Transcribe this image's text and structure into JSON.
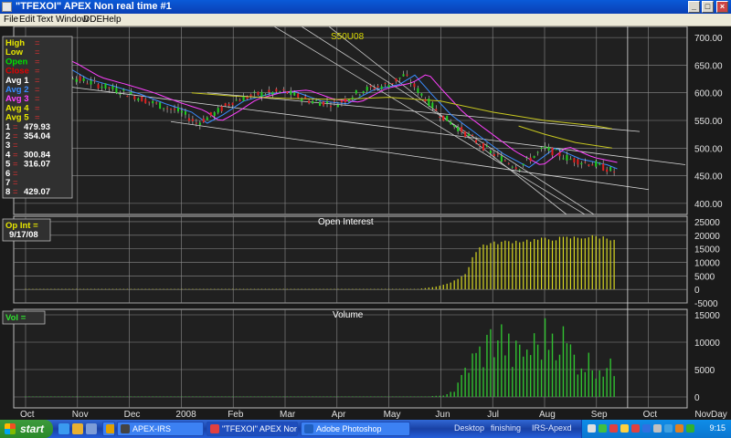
{
  "window": {
    "title": "\"TFEXOI\" APEX Non real time #1",
    "buttons": [
      "_",
      "□",
      "×"
    ]
  },
  "menu": [
    "File",
    "Edit",
    "Text",
    "Window",
    "DDE",
    "Help"
  ],
  "price_panel": {
    "symbol_label": "S50U08",
    "y_ticks": [
      "700.00",
      "650.00",
      "600.00",
      "550.00",
      "500.00",
      "450.00",
      "400.00"
    ],
    "legend": [
      {
        "label": "High",
        "value": "=",
        "color": "#e8e800"
      },
      {
        "label": "Low",
        "value": "=",
        "color": "#e8e800"
      },
      {
        "label": "Open",
        "value": "=",
        "color": "#00e000"
      },
      {
        "label": "Close",
        "value": "=",
        "color": "#e00000"
      },
      {
        "label": "Avg 1",
        "value": "=",
        "color": "#ffffff"
      },
      {
        "label": "Avg 2",
        "value": "=",
        "color": "#3a8cff"
      },
      {
        "label": "Avg 3",
        "value": "=",
        "color": "#ff40ff"
      },
      {
        "label": "Avg 4",
        "value": "=",
        "color": "#e8e800"
      },
      {
        "label": "Avg 5",
        "value": "=",
        "color": "#e8e800"
      },
      {
        "label": "1",
        "value": "= 479.93",
        "color": "#ffffff"
      },
      {
        "label": "2",
        "value": "= 354.04",
        "color": "#ffffff"
      },
      {
        "label": "3",
        "value": "=",
        "color": "#ffffff"
      },
      {
        "label": "4",
        "value": "= 300.84",
        "color": "#ffffff"
      },
      {
        "label": "5",
        "value": "= 316.07",
        "color": "#ffffff"
      },
      {
        "label": "6",
        "value": "=",
        "color": "#ffffff"
      },
      {
        "label": "7",
        "value": "=",
        "color": "#ffffff"
      },
      {
        "label": "8",
        "value": "= 429.07",
        "color": "#ffffff"
      }
    ]
  },
  "oi_panel": {
    "title": "Open  Interest",
    "label": "Op  Int  =",
    "date": "9/17/08",
    "y_ticks": [
      "25000",
      "20000",
      "15000",
      "10000",
      "5000",
      "0",
      "-5000"
    ]
  },
  "vol_panel": {
    "title": "Volume",
    "label": "Vol    =",
    "y_ticks": [
      "15000",
      "10000",
      "5000",
      "0"
    ]
  },
  "x_axis": [
    "Oct",
    "Nov",
    "Dec",
    "2008",
    "Feb",
    "Mar",
    "Apr",
    "May",
    "Jun",
    "Jul",
    "Aug",
    "Sep",
    "Oct",
    "Nov",
    "Day"
  ],
  "colors": {
    "grid": "#8c8c8c",
    "panel_bg": "#202020",
    "oi_bar": "#d8d820",
    "vol_bar": "#30c030",
    "axis_text": "#e0e0e0"
  },
  "taskbar": {
    "start": "start",
    "tasks": [
      {
        "label": "",
        "icon_color": "#e0a000"
      },
      {
        "label": "APEX-IRS",
        "icon_color": "#444444"
      },
      {
        "label": "\"TFEXOI\" APEX Non r...",
        "icon_color": "#e04040"
      },
      {
        "label": "Adobe Photoshop",
        "icon_color": "#2060c0"
      }
    ],
    "tray_labels": [
      "Desktop",
      "finishing",
      "IRS-Apexd"
    ],
    "clock": "9:15"
  },
  "chart_data": {
    "type": "candlestick-with-histograms",
    "x_labels": [
      "Oct",
      "Nov",
      "Dec",
      "2008",
      "Feb",
      "Mar",
      "Apr",
      "May",
      "Jun",
      "Jul",
      "Aug",
      "Sep",
      "Oct",
      "Nov"
    ],
    "price_ylim": [
      380,
      720
    ],
    "price_ticks": [
      700,
      650,
      600,
      550,
      500,
      450,
      400
    ],
    "price_path": [
      [
        0,
        670
      ],
      [
        0.5,
        652
      ],
      [
        1,
        625
      ],
      [
        1.5,
        612
      ],
      [
        2,
        598
      ],
      [
        2.5,
        580
      ],
      [
        3,
        565
      ],
      [
        3.3,
        545
      ],
      [
        3.6,
        560
      ],
      [
        4,
        585
      ],
      [
        4.5,
        598
      ],
      [
        5,
        602
      ],
      [
        5.5,
        585
      ],
      [
        6,
        580
      ],
      [
        6.5,
        605
      ],
      [
        7,
        615
      ],
      [
        7.3,
        632
      ],
      [
        7.6,
        600
      ],
      [
        8,
        560
      ],
      [
        8.5,
        525
      ],
      [
        9,
        490
      ],
      [
        9.5,
        465
      ],
      [
        10,
        500
      ],
      [
        10.5,
        480
      ],
      [
        11,
        470
      ],
      [
        11.4,
        455
      ]
    ],
    "oi_ylim": [
      -5000,
      27000
    ],
    "oi_ticks": [
      25000,
      20000,
      15000,
      10000,
      5000,
      0,
      -5000
    ],
    "oi_path": [
      [
        0,
        0
      ],
      [
        7.5,
        0
      ],
      [
        7.9,
        1000
      ],
      [
        8.2,
        2500
      ],
      [
        8.5,
        6000
      ],
      [
        8.6,
        12000
      ],
      [
        8.8,
        16500
      ],
      [
        9.2,
        17500
      ],
      [
        10,
        18500
      ],
      [
        11,
        19500
      ],
      [
        11.4,
        18500
      ]
    ],
    "vol_ylim": [
      -2000,
      16000
    ],
    "vol_ticks": [
      15000,
      10000,
      5000,
      0
    ],
    "vol_path": [
      [
        0,
        0
      ],
      [
        7.5,
        0
      ],
      [
        8,
        200
      ],
      [
        8.3,
        1500
      ],
      [
        8.5,
        6000
      ],
      [
        8.8,
        9000
      ],
      [
        9.1,
        12800
      ],
      [
        9.4,
        8000
      ],
      [
        9.8,
        10000
      ],
      [
        10.2,
        13500
      ],
      [
        10.6,
        7500
      ],
      [
        11,
        6500
      ],
      [
        11.4,
        5000
      ]
    ]
  }
}
